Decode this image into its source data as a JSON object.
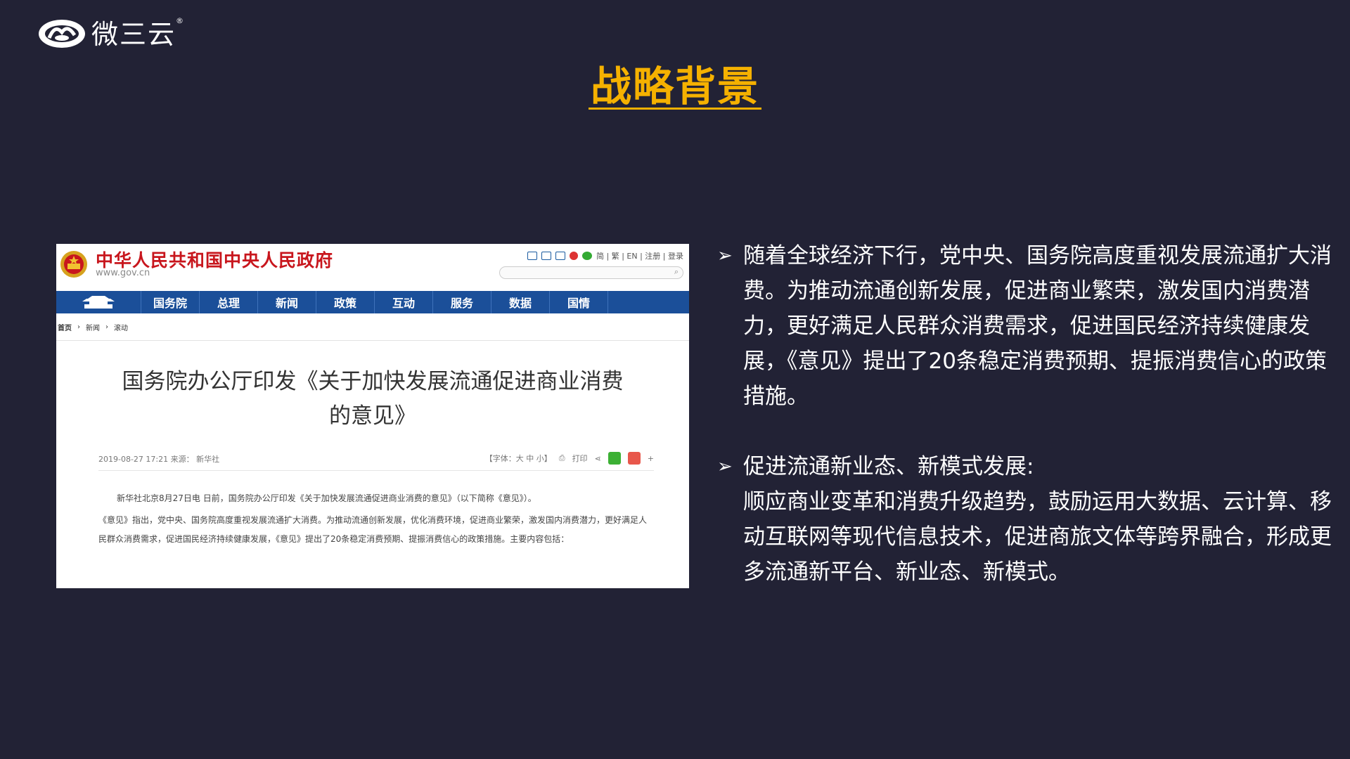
{
  "brand": {
    "name": "微三云",
    "reg": "®"
  },
  "title": "战略背景",
  "screenshot": {
    "site_title": "中华人民共和国中央人民政府",
    "site_url": "www.gov.cn",
    "tools": "简 | 繁 | EN | 注册 | 登录",
    "nav": [
      "国务院",
      "总理",
      "新闻",
      "政策",
      "互动",
      "服务",
      "数据",
      "国情"
    ],
    "breadcrumb": [
      "首页",
      "新闻",
      "滚动"
    ],
    "article_title_1": "国务院办公厅印发《关于加快发展流通促进商业消费",
    "article_title_2": "的意见》",
    "meta_left": "2019-08-27 17:21   来源： 新华社",
    "meta_font": "【字体：大 中 小】",
    "meta_print": "打印",
    "para1": "新华社北京8月27日电 日前，国务院办公厅印发《关于加快发展流通促进商业消费的意见》（以下简称《意见》）。",
    "para2": "《意见》指出，党中央、国务院高度重视发展流通扩大消费。为推动流通创新发展，优化消费环境，促进商业繁荣，激发国内消费潜力，更好满足人民群众消费需求，促进国民经济持续健康发展，《意见》提出了20条稳定消费预期、提振消费信心的政策措施。主要内容包括："
  },
  "points": [
    {
      "marker": "➢",
      "lines": [
        "随着全球经济下行，党中央、国务院高度重视发展流通扩大消费。为推动流通创新发展，促进商业繁荣，激发国内消费潜力，更好满足人民群众消费需求，促进国民经济持续健康发展，《意见》提出了20条稳定消费预期、提振消费信心的政策措施。"
      ]
    },
    {
      "marker": "➢",
      "lines": [
        "促进流通新业态、新模式发展:",
        "顺应商业变革和消费升级趋势，鼓励运用大数据、云计算、移动互联网等现代信息技术，促进商旅文体等跨界融合，形成更多流通新平台、新业态、新模式。"
      ]
    }
  ],
  "colors": {
    "background": "#222235",
    "accent": "#f5b100",
    "gov_red": "#c8161d",
    "gov_blue": "#1b4f99"
  }
}
